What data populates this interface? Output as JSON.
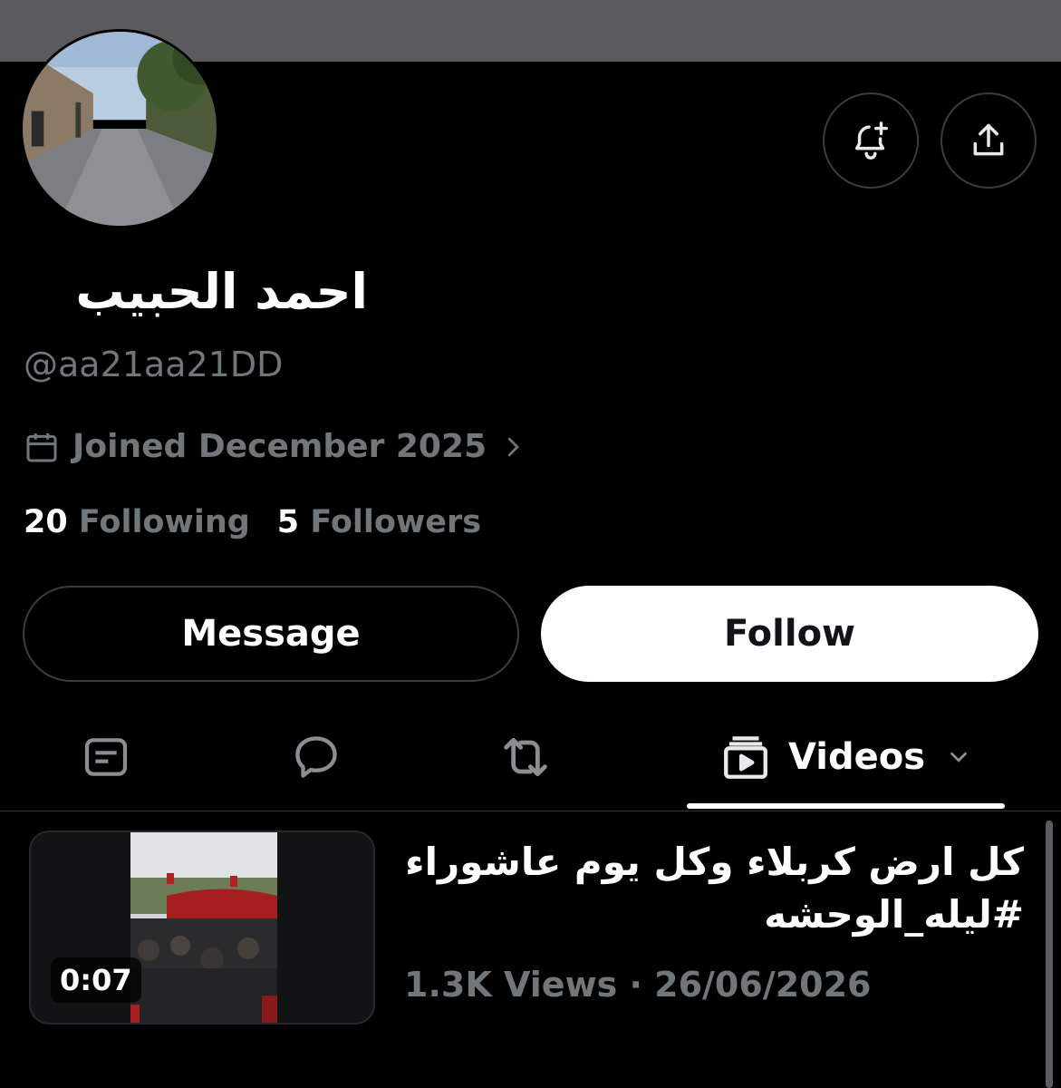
{
  "profile": {
    "name": "احمد الحبيب",
    "handle": "@aa21aa21DD",
    "joined": "Joined December 2025",
    "following_count": "20",
    "following_label": "Following",
    "followers_count": "5",
    "followers_label": "Followers"
  },
  "actions": {
    "message_label": "Message",
    "follow_label": "Follow",
    "notify_icon": "bell-plus-icon",
    "share_icon": "share-icon"
  },
  "tabs": {
    "items": [
      "posts-icon",
      "replies-icon",
      "reposts-icon",
      "videos"
    ],
    "active_label": "Videos"
  },
  "post": {
    "duration": "0:07",
    "text_line1": "كل ارض كربلاء وكل يوم عاشوراء",
    "text_line2": "#ليله_الوحشه",
    "views": "1.3K Views",
    "separator": "·",
    "date": "26/06/2026"
  },
  "colors": {
    "background": "#000000",
    "text_primary": "#e7e9ea",
    "text_secondary": "#71767b",
    "border": "#2f3336",
    "follow_bg": "#ffffff"
  }
}
